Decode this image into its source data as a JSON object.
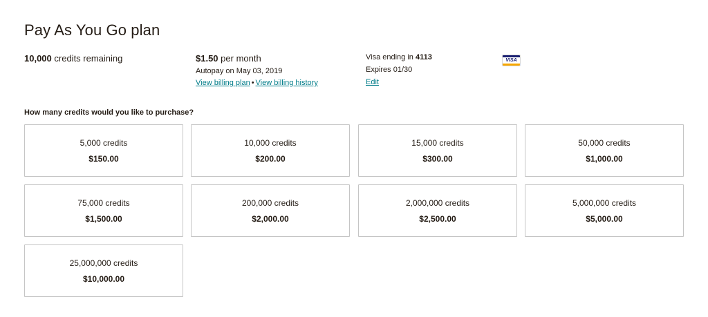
{
  "page": {
    "title": "Pay As You Go plan"
  },
  "summary": {
    "credits_value": "10,000",
    "credits_label": "credits remaining",
    "price_value": "$1.50",
    "price_label": "per month",
    "autopay": "Autopay on May 03, 2019",
    "view_plan_link": "View billing plan",
    "separator": "•",
    "view_history_link": "View billing history",
    "card_prefix": "Visa ending in",
    "card_last4": "4113",
    "expires": "Expires 01/30",
    "edit_link": "Edit",
    "card_brand": "VISA",
    "card_brand_colors": {
      "top": "#1a1f71",
      "bottom": "#f7a600"
    }
  },
  "purchase": {
    "question": "How many credits would you like to purchase?",
    "options": [
      {
        "credits": "5,000 credits",
        "price": "$150.00"
      },
      {
        "credits": "10,000 credits",
        "price": "$200.00"
      },
      {
        "credits": "15,000 credits",
        "price": "$300.00"
      },
      {
        "credits": "50,000 credits",
        "price": "$1,000.00"
      },
      {
        "credits": "75,000 credits",
        "price": "$1,500.00"
      },
      {
        "credits": "200,000 credits",
        "price": "$2,000.00"
      },
      {
        "credits": "2,000,000 credits",
        "price": "$2,500.00"
      },
      {
        "credits": "5,000,000 credits",
        "price": "$5,000.00"
      },
      {
        "credits": "25,000,000 credits",
        "price": "$10,000.00"
      }
    ]
  },
  "colors": {
    "text": "#241c15",
    "link": "#007c89",
    "border": "#c5c5c5"
  }
}
